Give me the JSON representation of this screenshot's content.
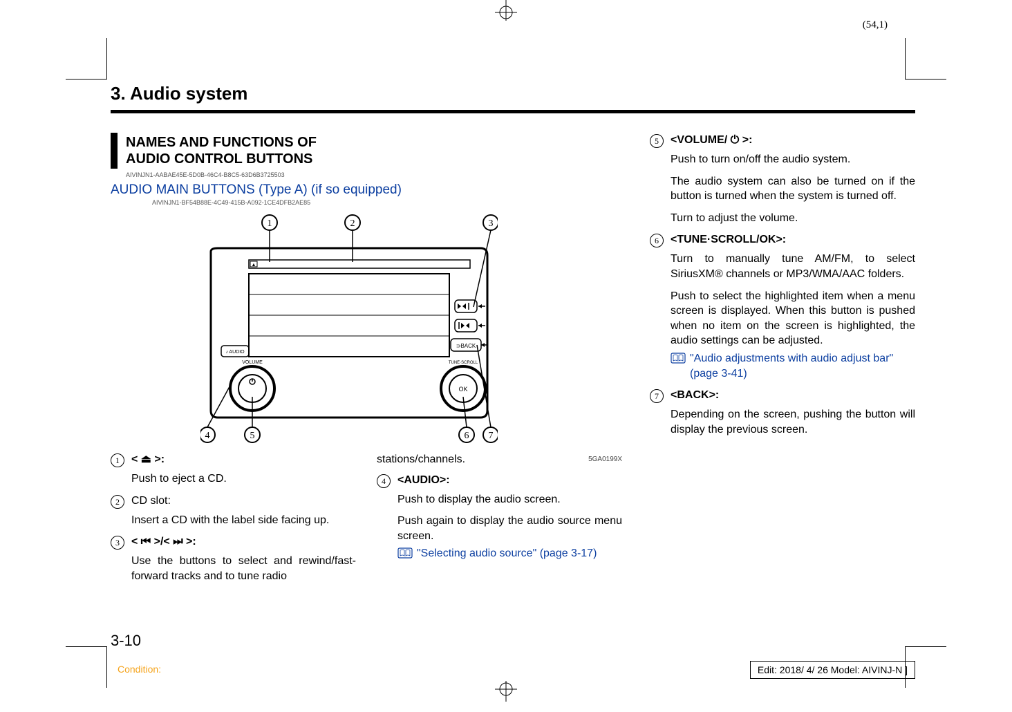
{
  "page_coord": "(54,1)",
  "chapter_title": "3. Audio system",
  "section_heading_line1": "NAMES AND FUNCTIONS OF",
  "section_heading_line2": "AUDIO CONTROL BUTTONS",
  "guid1": "AIVINJN1-AABAE45E-5D0B-46C4-B8C5-63D6B3725503",
  "sub_heading": "AUDIO MAIN BUTTONS (Type A) (if so equipped)",
  "guid2": "AIVINJN1-BF54B88E-4C49-415B-A092-1CE4DFB2AE85",
  "image_code": "5GA0199X",
  "items": {
    "n1": {
      "label": "< ⏏ >:",
      "desc": "Push to eject a CD."
    },
    "n2": {
      "label": "CD slot:",
      "desc": "Insert a CD with the label side facing up."
    },
    "n3": {
      "label": "< ⏮ >/< ⏭ >:",
      "desc": "Use the buttons to select and rewind/fast-forward tracks and to tune radio"
    },
    "n3_cont": "stations/channels.",
    "n4": {
      "label": "<AUDIO>:",
      "desc1": "Push to display the audio screen.",
      "desc2": "Push again to display the audio source menu screen.",
      "ref": "\"Selecting audio source\" (page 3-17)"
    },
    "n5": {
      "label": "<VOLUME/ ⏻ >:",
      "desc1": "Push to turn on/off the audio system.",
      "desc2": "The audio system can also be turned on if the button is turned when the system is turned off.",
      "desc3": "Turn to adjust the volume."
    },
    "n6": {
      "label": "<TUNE·SCROLL/OK>:",
      "desc1": "Turn to manually tune AM/FM, to select SiriusXM® channels or MP3/WMA/AAC folders.",
      "desc2": "Push to select the highlighted item when a menu screen is displayed. When this button is pushed when no item on the screen is highlighted, the audio settings can be adjusted.",
      "ref": "\"Audio adjustments with audio adjust bar\" (page 3-41)"
    },
    "n7": {
      "label": "<BACK>:",
      "desc1": "Depending on the screen, pushing the button will display the previous screen."
    }
  },
  "page_number": "3-10",
  "footer_left": "Condition:",
  "footer_right": "Edit: 2018/ 4/ 26    Model: AIVINJ-N ]"
}
